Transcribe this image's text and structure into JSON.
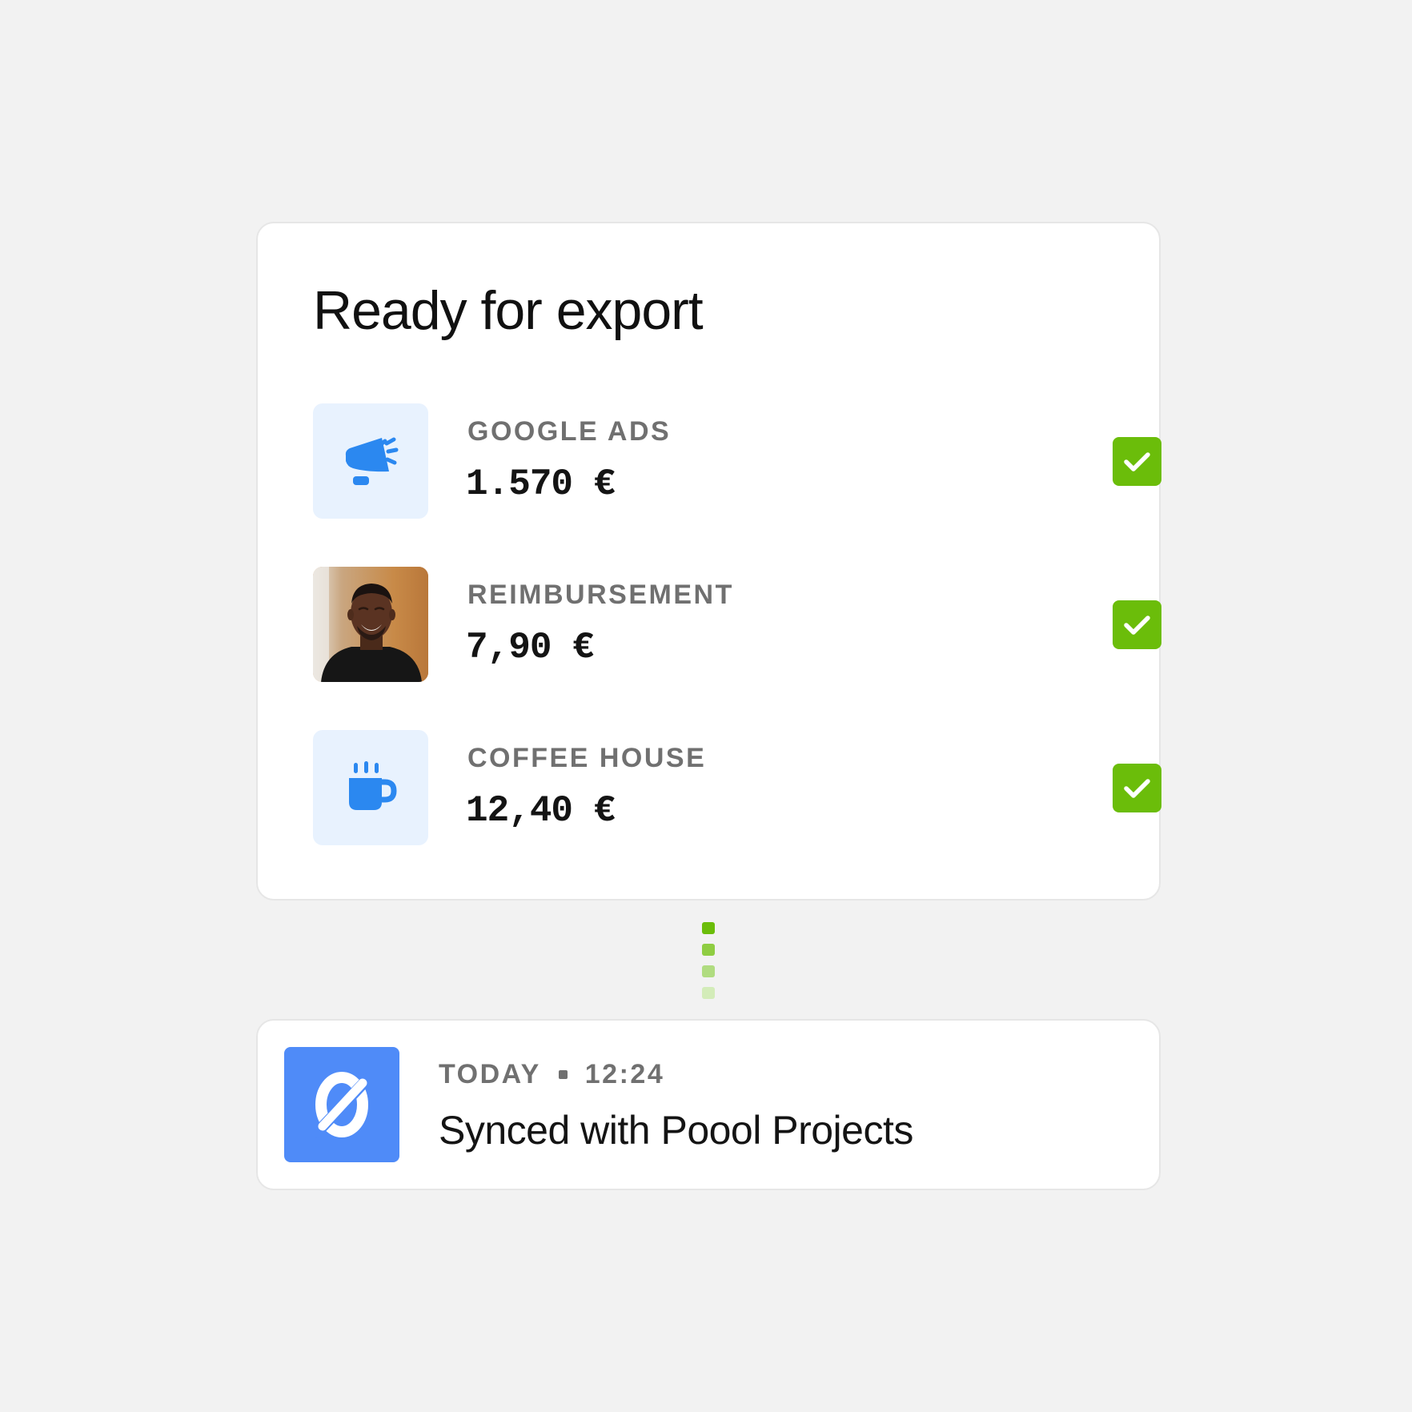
{
  "export_card": {
    "title": "Ready for export",
    "items": [
      {
        "label": "GOOGLE ADS",
        "amount": "1.570 €",
        "icon": "megaphone-icon",
        "status": "checked"
      },
      {
        "label": "REIMBURSEMENT",
        "amount": "7,90 €",
        "icon": "avatar-photo",
        "status": "checked"
      },
      {
        "label": "COFFEE HOUSE",
        "amount": "12,40 €",
        "icon": "coffee-cup-icon",
        "status": "checked"
      }
    ]
  },
  "sync_card": {
    "day": "TODAY",
    "time": "12:24",
    "title": "Synced with Poool Projects",
    "logo_icon": "poool-logo-icon"
  },
  "colors": {
    "background": "#f2f2f2",
    "card": "#ffffff",
    "accent_green": "#6bbd0a",
    "icon_blue": "#2b88f0",
    "icon_tile": "#e8f2fe",
    "logo_blue": "#4f8bf8",
    "label_gray": "#707070"
  }
}
